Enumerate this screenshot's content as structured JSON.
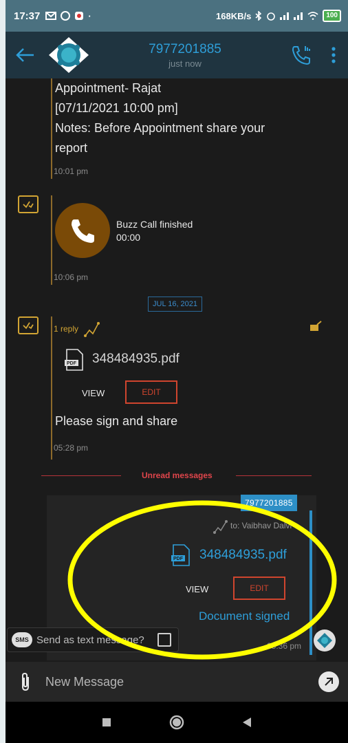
{
  "status_bar": {
    "time": "17:37",
    "net_speed": "168KB/s",
    "battery": "100"
  },
  "header": {
    "contact_number": "7977201885",
    "presence": "just now"
  },
  "messages": {
    "m1": {
      "line1": "Appointment- Rajat",
      "line2": "[07/11/2021 10:00 pm]",
      "line3": "Notes: Before Appointment share your",
      "line4": "report",
      "time": "10:01 pm"
    },
    "m2": {
      "call_status": "Buzz Call finished",
      "duration": "00:00",
      "time": "10:06 pm"
    },
    "date_divider": "JUL 16, 2021",
    "m3": {
      "reply_count": "1 reply",
      "file_name": "348484935.pdf",
      "view_label": "VIEW",
      "edit_label": "EDIT",
      "text": "Please sign and share",
      "time": "05:28 pm"
    },
    "unread_label": "Unread messages",
    "m4": {
      "sender": "7977201885",
      "to_label": "to: Vaibhav Dalvi",
      "file_name": "348484935.pdf",
      "view_label": "VIEW",
      "edit_label": "EDIT",
      "status_text": "Document signed",
      "time": "05:36 pm"
    }
  },
  "sms_toggle": {
    "label": "Send as text message?",
    "badge": "SMS"
  },
  "composer": {
    "placeholder": "New Message"
  },
  "colors": {
    "accent_blue": "#2e9ed8",
    "incoming_rule": "#8d6a2a",
    "edit_red": "#d0452e",
    "highlight_yellow": "#ffff00"
  }
}
